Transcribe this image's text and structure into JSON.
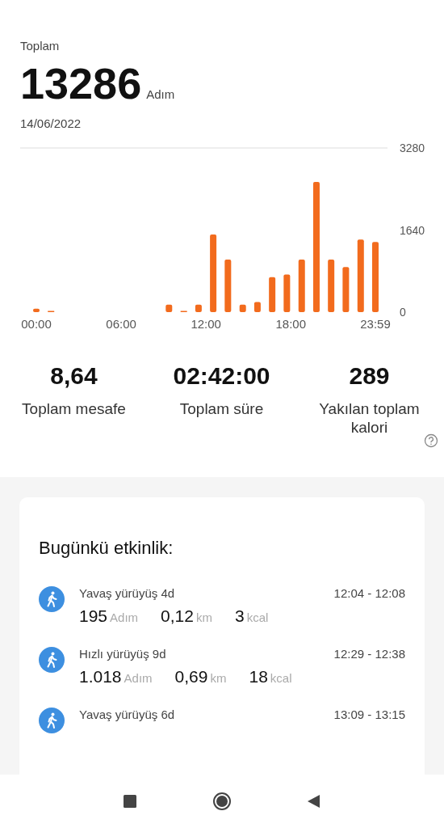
{
  "summary": {
    "label": "Toplam",
    "steps": "13286",
    "unit": "Adım",
    "date": "14/06/2022"
  },
  "chart": {
    "chart_data": {
      "type": "bar",
      "x": [
        0,
        1.04,
        2.09,
        3.13,
        4.17,
        5.21,
        6.26,
        7.3,
        8.34,
        9.38,
        10.43,
        11.47,
        12.51,
        13.55,
        14.6,
        15.64,
        16.68,
        17.72,
        18.77,
        19.81,
        20.85,
        21.89,
        22.94,
        23.98
      ],
      "series": [
        {
          "color": "#f26b1d",
          "values": [
            70,
            0,
            null,
            null,
            null,
            null,
            null,
            null,
            null,
            150,
            0,
            150,
            1550,
            1050,
            150,
            200,
            700,
            750,
            1050,
            2600,
            1050,
            900,
            1450,
            1400
          ]
        }
      ],
      "xlim": [
        0,
        23.98
      ],
      "ylim": [
        0,
        3280
      ],
      "yticks": [
        0,
        1640,
        3280
      ],
      "xticks": [
        {
          "value": 0,
          "label": "00:00"
        },
        {
          "value": 6,
          "label": "06:00"
        },
        {
          "value": 12,
          "label": "12:00"
        },
        {
          "value": 18,
          "label": "18:00"
        },
        {
          "value": 23.98,
          "label": "23:59"
        }
      ]
    }
  },
  "stats": [
    {
      "value": "8,64",
      "label": "Toplam mesafe",
      "help": false
    },
    {
      "value": "02:42:00",
      "label": "Toplam süre",
      "help": false
    },
    {
      "value": "289",
      "label": "Yakılan toplam kalori",
      "help": true
    }
  ],
  "activity": {
    "title": "Bugünkü etkinlik:",
    "items": [
      {
        "name": "Yavaş yürüyüş 4d",
        "time": "12:04 - 12:08",
        "metrics": [
          {
            "value": "195",
            "unit": "Adım"
          },
          {
            "value": "0,12",
            "unit": "km"
          },
          {
            "value": "3",
            "unit": "kcal"
          }
        ]
      },
      {
        "name": "Hızlı yürüyüş 9d",
        "time": "12:29 - 12:38",
        "metrics": [
          {
            "value": "1.018",
            "unit": "Adım"
          },
          {
            "value": "0,69",
            "unit": "km"
          },
          {
            "value": "18",
            "unit": "kcal"
          }
        ]
      },
      {
        "name": "Yavaş yürüyüş 6d",
        "time": "13:09 - 13:15"
      }
    ]
  },
  "nav": [
    {
      "kind": "recents"
    },
    {
      "kind": "home"
    },
    {
      "kind": "back"
    }
  ]
}
